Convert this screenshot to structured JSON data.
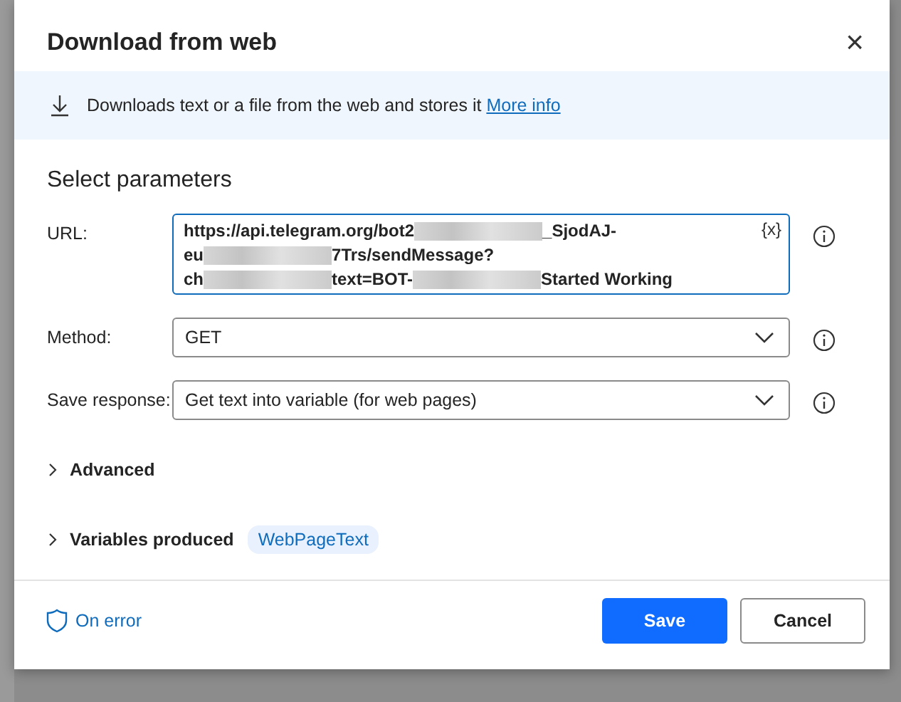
{
  "dialog": {
    "title": "Download from web",
    "close_icon": "×"
  },
  "banner": {
    "text": "Downloads text or a file from the web and stores it",
    "link": "More info"
  },
  "section_title": "Select parameters",
  "fields": [
    {
      "kind": "multiline",
      "label": "URL:",
      "lines": [
        [
          {
            "kind": "text",
            "text": "https://api.telegram.org/bot2"
          },
          {
            "kind": "redacted"
          },
          {
            "kind": "text",
            "text": "_SjodAJ-"
          }
        ],
        [
          {
            "kind": "text",
            "text": "eu"
          },
          {
            "kind": "redacted"
          },
          {
            "kind": "text",
            "text": "7Trs/sendMessage?"
          }
        ],
        [
          {
            "kind": "text",
            "text": "ch"
          },
          {
            "kind": "redacted"
          },
          {
            "kind": "text",
            "text": "text=BOT-"
          },
          {
            "kind": "redacted"
          },
          {
            "kind": "text",
            "text": "Started Working"
          }
        ]
      ],
      "variable_button": "{x}"
    },
    {
      "kind": "dropdown",
      "label": "Method:",
      "value": "GET"
    },
    {
      "kind": "dropdown",
      "label": "Save response:",
      "value": "Get text into variable (for web pages)"
    }
  ],
  "sections": [
    {
      "label": "Advanced",
      "expanded": false
    },
    {
      "label": "Variables produced",
      "expanded": false,
      "tags": [
        "WebPageText"
      ]
    }
  ],
  "footer": {
    "on_error": "On error",
    "buttons": [
      {
        "label": "Save",
        "kind": "primary"
      },
      {
        "label": "Cancel",
        "kind": "secondary"
      }
    ]
  }
}
